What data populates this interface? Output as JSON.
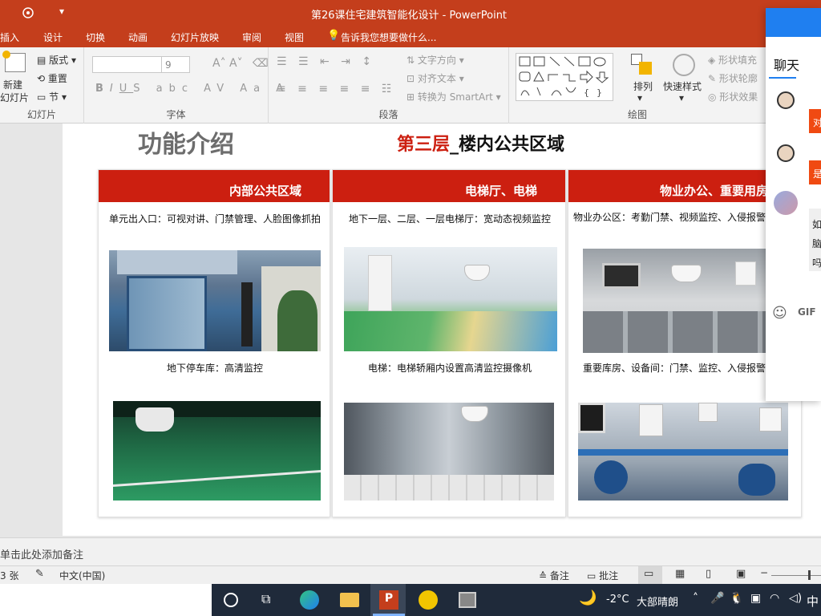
{
  "window": {
    "title": "第26课住宅建筑智能化设计 - PowerPoint"
  },
  "tabs": [
    "插入",
    "设计",
    "切换",
    "动画",
    "幻灯片放映",
    "审阅",
    "视图"
  ],
  "tell_me": "告诉我您想要做什么...",
  "ribbon": {
    "slides": {
      "new_slide_l1": "新建",
      "new_slide_l2": "幻灯片",
      "layout": "版式",
      "reset": "重置",
      "section": "节",
      "group": "幻灯片"
    },
    "font": {
      "size": "9",
      "group": "字体"
    },
    "paragraph": {
      "text_direction": "文字方向",
      "align_text": "对齐文本",
      "smartart": "转换为 SmartArt",
      "group": "段落"
    },
    "drawing": {
      "arrange": "排列",
      "quick_styles": "快速样式",
      "shape_fill": "形状填充",
      "shape_outline": "形状轮廓",
      "shape_effects": "形状效果",
      "group": "绘图"
    }
  },
  "slide": {
    "heading": "功能介绍",
    "layer_red": "第三层",
    "layer_rest": "_楼内公共区域",
    "columns": [
      {
        "header": "内部公共区域",
        "cap1": "单元出入口：可视对讲、门禁管理、人脸图像抓拍",
        "cap2": "地下停车库：高清监控"
      },
      {
        "header": "电梯厅、电梯",
        "cap1": "地下一层、二层、一层电梯厅：宽动态视频监控",
        "cap2": "电梯：电梯轿厢内设置高清监控摄像机"
      },
      {
        "header": "物业办公、重要用房",
        "cap1": "物业办公区：考勤门禁、视频监控、入侵报警",
        "cap2": "重要库房、设备间：门禁、监控、入侵报警"
      }
    ]
  },
  "notes": {
    "placeholder": "单击此处添加备注"
  },
  "status": {
    "slides": "3 张",
    "language": "中文(中国)",
    "notes_btn": "备注",
    "comments_btn": "批注"
  },
  "taskbar": {
    "weather_temp": "-2°C",
    "weather_desc": "大部晴朗",
    "ime": "中"
  },
  "chat": {
    "tab": "聊天",
    "gif": "GIF",
    "msg1": "对",
    "msg2": "是",
    "msg3a": "如",
    "msg3b": "脑",
    "msg3c": "吗"
  },
  "colors": {
    "accent": "#c43e1c",
    "header_red": "#cc1f10",
    "taskbar": "#1f2a3a"
  }
}
